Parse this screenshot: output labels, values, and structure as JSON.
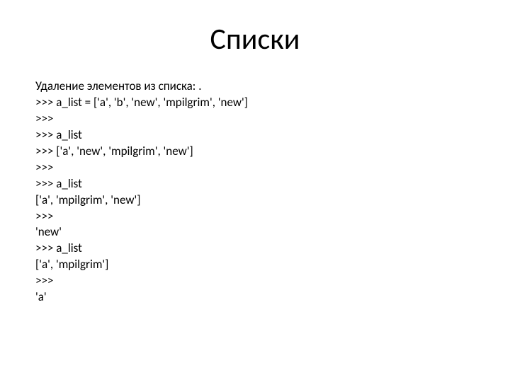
{
  "slide": {
    "title": "Списки",
    "lines": [
      "Удаление элементов из списка: .",
      ">>> a_list = ['a', 'b', 'new', 'mpilgrim', 'new']",
      ">>>",
      ">>> a_list",
      ">>> ['a', 'new', 'mpilgrim', 'new']",
      ">>>",
      ">>> a_list",
      "['a', 'mpilgrim', 'new']",
      ">>>",
      "'new'",
      ">>> a_list",
      "['a', 'mpilgrim']",
      ">>>",
      "'a'"
    ]
  }
}
